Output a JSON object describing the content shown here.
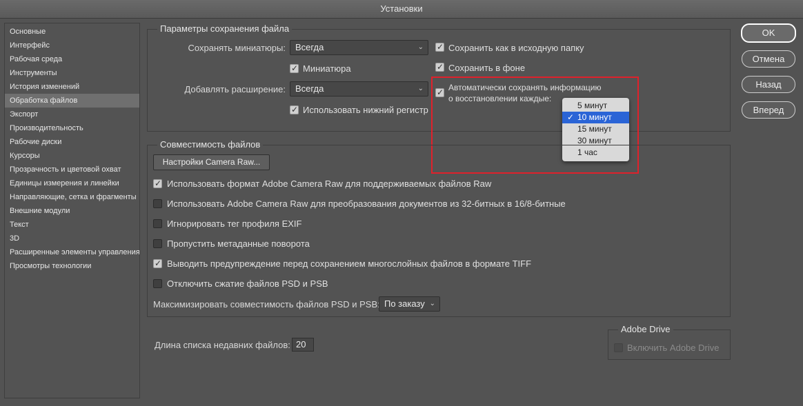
{
  "window": {
    "title": "Установки"
  },
  "sidebar": {
    "items": [
      {
        "label": "Основные"
      },
      {
        "label": "Интерфейс"
      },
      {
        "label": "Рабочая среда"
      },
      {
        "label": "Инструменты"
      },
      {
        "label": "История изменений"
      },
      {
        "label": "Обработка файлов",
        "selected": true
      },
      {
        "label": "Экспорт"
      },
      {
        "label": "Производительность"
      },
      {
        "label": "Рабочие диски"
      },
      {
        "label": "Курсоры"
      },
      {
        "label": "Прозрачность и цветовой охват"
      },
      {
        "label": "Единицы измерения и линейки"
      },
      {
        "label": "Направляющие, сетка и фрагменты"
      },
      {
        "label": "Внешние модули"
      },
      {
        "label": "Текст"
      },
      {
        "label": "3D"
      },
      {
        "label": "Расширенные элементы управления"
      },
      {
        "label": "Просмотры технологии"
      }
    ]
  },
  "save_options": {
    "title": "Параметры сохранения файла",
    "thumbnails_label": "Сохранять миниатюры:",
    "thumbnails_value": "Всегда",
    "thumbnail_checkbox": "Миниатюра",
    "extension_label": "Добавлять расширение:",
    "extension_value": "Всегда",
    "lowercase_checkbox": "Использовать нижний регистр",
    "save_to_original": "Сохранить как в исходную папку",
    "save_background": "Сохранить в фоне",
    "autosave_line1": "Автоматически сохранять информацию",
    "autosave_line2": "о восстановлении каждые:"
  },
  "autosave_popup": {
    "check_glyph": "✓",
    "options": [
      {
        "label": "5 минут",
        "selected": false
      },
      {
        "label": "10 минут",
        "selected": true
      },
      {
        "label": "15 минут",
        "selected": false
      },
      {
        "label": "30 минут",
        "selected": false
      },
      {
        "label": "1 час",
        "selected": false
      }
    ]
  },
  "compat": {
    "title": "Совместимость файлов",
    "camera_raw_button": "Настройки Camera Raw...",
    "options": [
      {
        "label": "Использовать формат Adobe Camera Raw для поддерживаемых файлов Raw",
        "checked": true
      },
      {
        "label": "Использовать Adobe Camera Raw для преобразования документов из 32-битных в 16/8-битные",
        "checked": false
      },
      {
        "label": "Игнорировать тег профиля EXIF",
        "checked": false
      },
      {
        "label": "Пропустить метаданные поворота",
        "checked": false
      },
      {
        "label": "Выводить предупреждение перед сохранением многослойных файлов в формате TIFF",
        "checked": true
      },
      {
        "label": "Отключить сжатие файлов PSD и PSB",
        "checked": false
      }
    ],
    "maximize_label": "Максимизировать совместимость файлов PSD и PSB:",
    "maximize_value": "По заказу"
  },
  "recent": {
    "label": "Длина списка недавних файлов:",
    "value": "20"
  },
  "adobe_drive": {
    "title": "Adobe Drive",
    "checkbox": "Включить Adobe Drive"
  },
  "buttons": {
    "ok": "OK",
    "cancel": "Отмена",
    "back": "Назад",
    "next": "Вперед"
  },
  "icons": {
    "check": "✓",
    "chevron": "chevron-up-down-icon"
  },
  "colors": {
    "highlight": "#e0212b",
    "popup_selected": "#2a64d6"
  }
}
